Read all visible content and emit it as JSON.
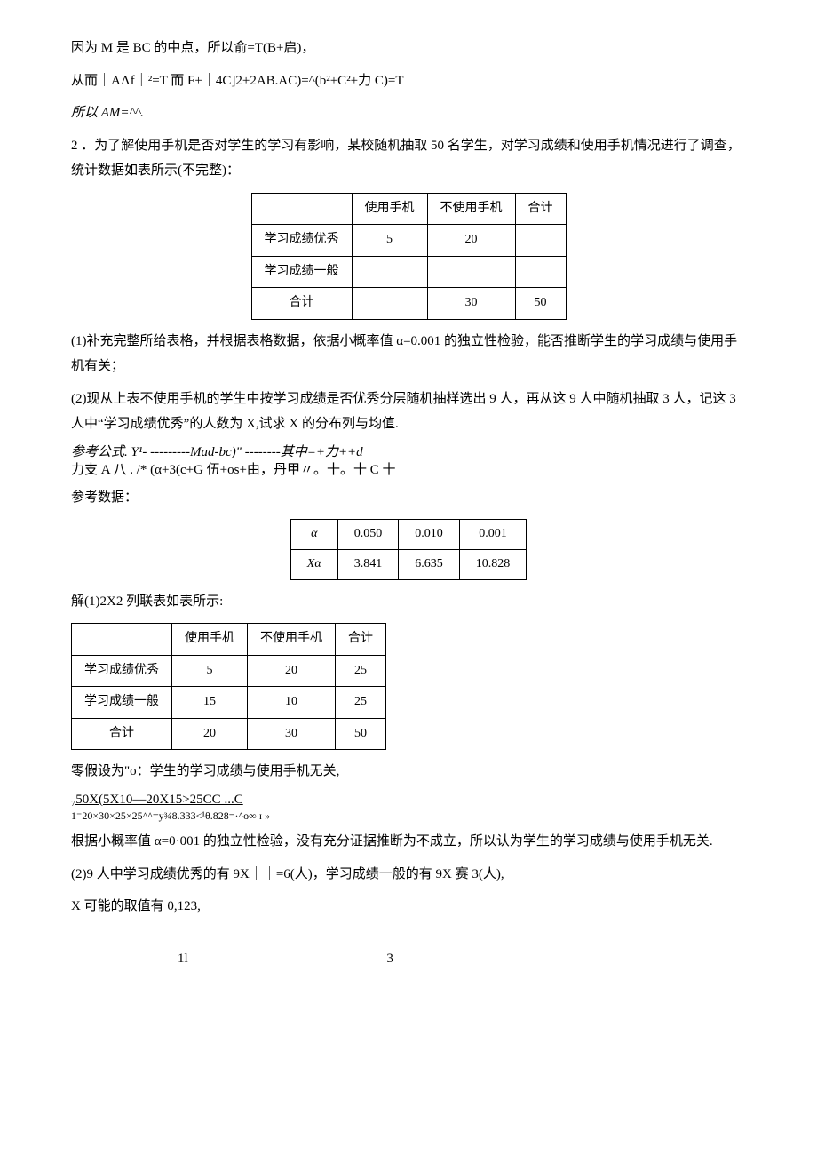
{
  "para1": "因为 M 是 BC 的中点，所以俞=T(B+启)，",
  "para2": "从而｜AΛf｜²=T 而 F+｜4C]2+2AΒ.AC)=^(b²+C²+力 C)=T",
  "para3": "所以 AM=^^.",
  "para4": "2 ．为了解使用手机是否对学生的学习有影响，某校随机抽取 50 名学生，对学习成绩和使用手机情况进行了调查，统计数据如表所示(不完整)：",
  "table1": {
    "headers": [
      "",
      "使用手机",
      "不使用手机",
      "合计"
    ],
    "rows": [
      {
        "label": "学习成绩优秀",
        "c1": "5",
        "c2": "20",
        "c3": ""
      },
      {
        "label": "学习成绩一般",
        "c1": "",
        "c2": "",
        "c3": ""
      },
      {
        "label": "合计",
        "c1": "",
        "c2": "30",
        "c3": "50"
      }
    ]
  },
  "para5": "(1)补充完整所给表格，并根据表格数据，依据小概率值 α=0.001 的独立性检验，能否推断学生的学习成绩与使用手机有关；",
  "para6": "(2)现从上表不使用手机的学生中按学习成绩是否优秀分层随机抽样选出 9 人，再从这 9 人中随机抽取 3 人，记这 3 人中“学习成绩优秀”的人数为 X,试求 X 的分布列与均值.",
  "formula_line1": "参考公式. Y¹- ---------Mad-bc)\" --------其中=+力++d",
  "formula_line2": "力支 A 八 . /*    (α+3(c+G 伍+os+由，丹甲〃。十。十 C 十",
  "para7": "参考数据：",
  "table2": {
    "row1": {
      "h": "α",
      "c1": "0.050",
      "c2": "0.010",
      "c3": "0.001"
    },
    "row2": {
      "h": "Xα",
      "c1": "3.841",
      "c2": "6.635",
      "c3": "10.828"
    }
  },
  "para8": "解(1)2X2 列联表如表所示:",
  "table3": {
    "headers": [
      "",
      "使用手机",
      "不使用手机",
      "合计"
    ],
    "rows": [
      {
        "label": "学习成绩优秀",
        "c1": "5",
        "c2": "20",
        "c3": "25"
      },
      {
        "label": "学习成绩一般",
        "c1": "15",
        "c2": "10",
        "c3": "25"
      },
      {
        "label": "合计",
        "c1": "20",
        "c2": "30",
        "c3": "50"
      }
    ]
  },
  "para9": "零假设为\"o：学生的学习成绩与使用手机无关,",
  "calc_line1": "₇50X(5X10—20X15>25CC                    ...C",
  "calc_line2": "1⁻20×30×25×25^^=y¾8.333<¹θ.828=·^o∞ ɪ »",
  "para10": "根据小概率值 α=0·001 的独立性检验，没有充分证据推断为不成立，所以认为学生的学习成绩与使用手机无关.",
  "para11": "(2)9 人中学习成绩优秀的有 9X｜｜=6(人)，学习成绩一般的有 9X 赛 3(人),",
  "para12": "X 可能的取值有 0,123,",
  "footer_left": "1l",
  "footer_right": "3"
}
